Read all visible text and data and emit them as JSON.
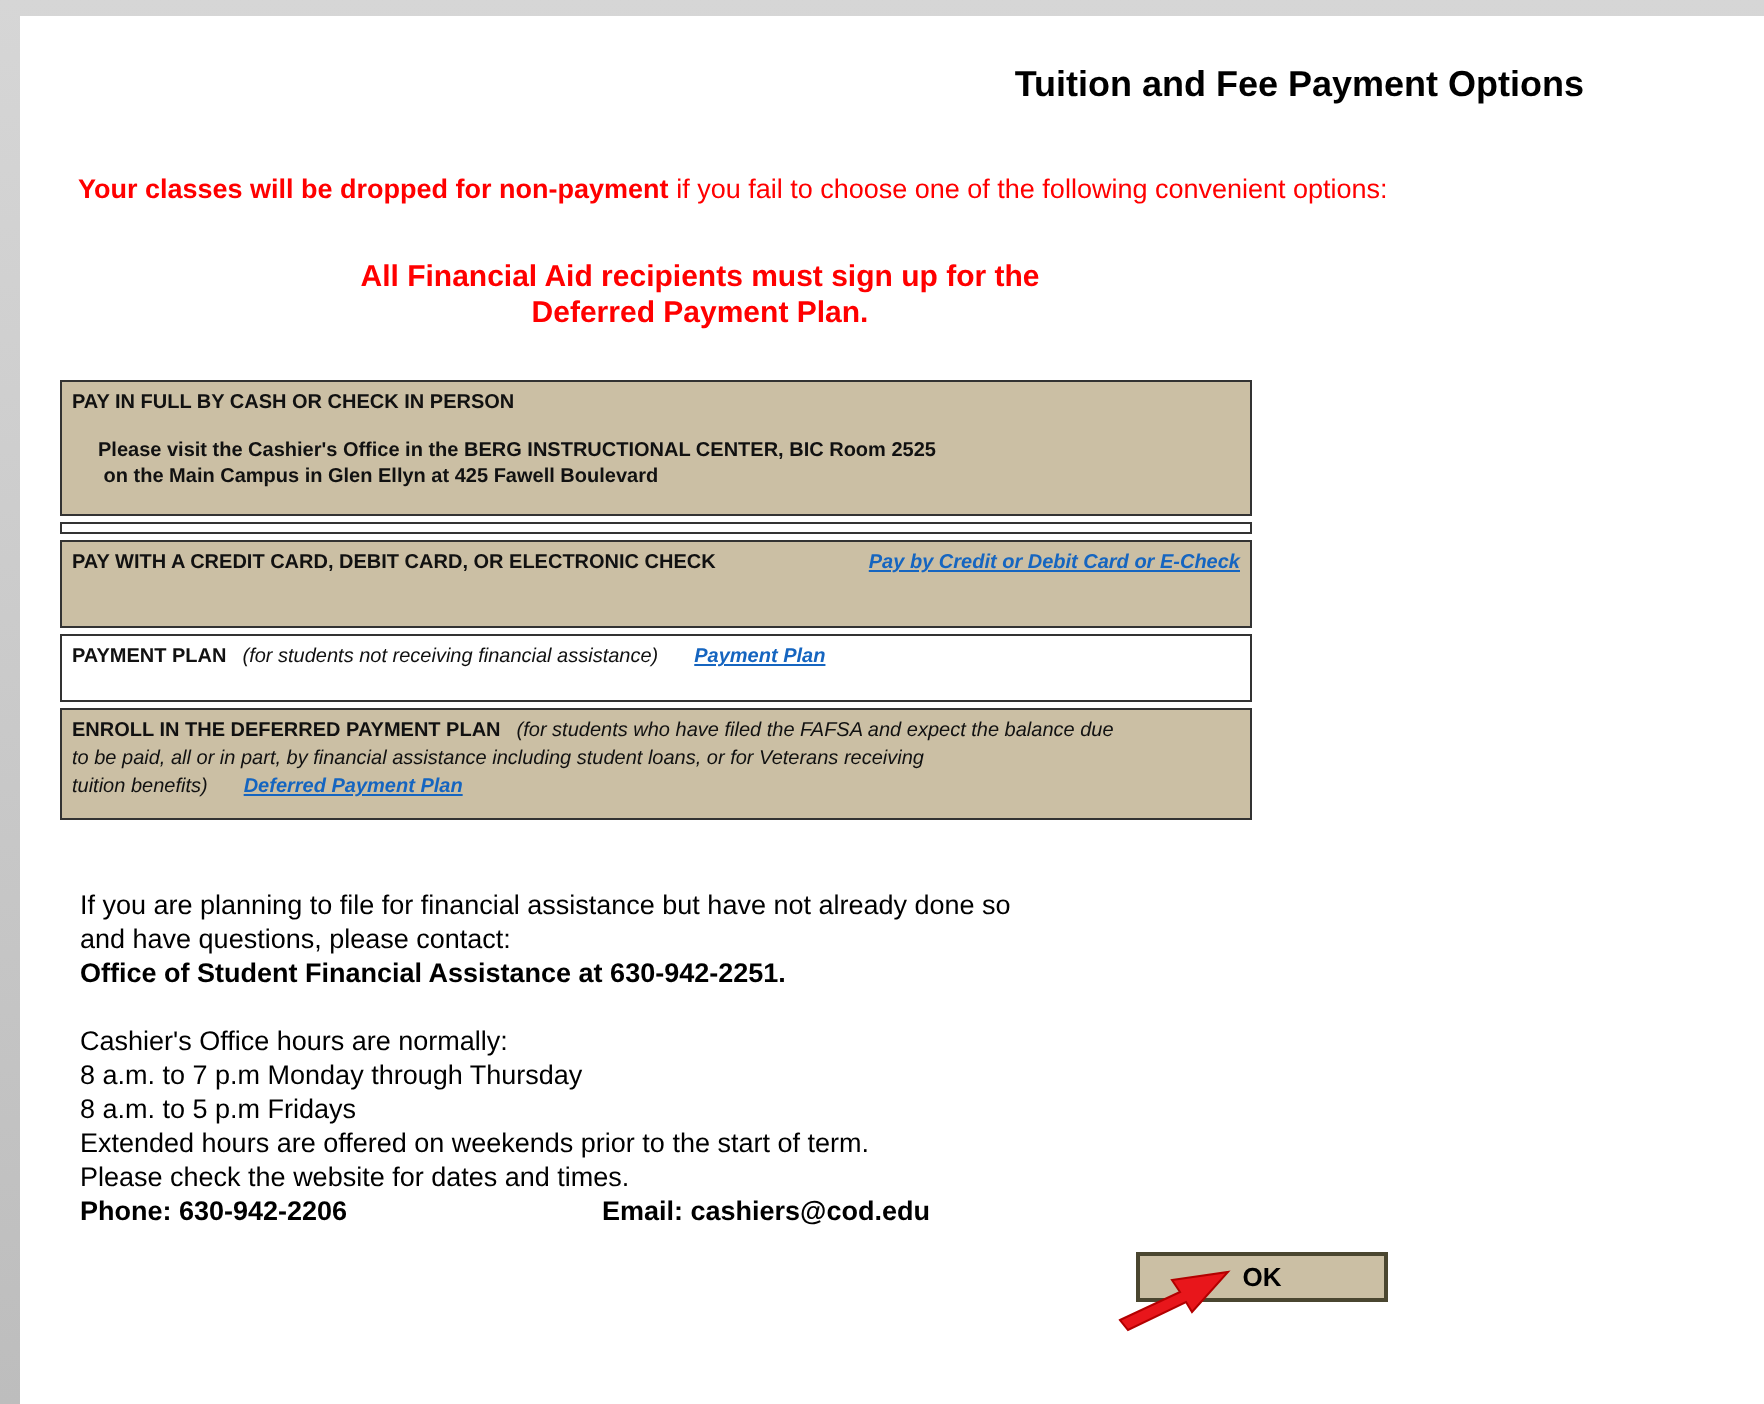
{
  "title": "Tuition and Fee Payment Options",
  "warning": {
    "bold": "Your classes will be dropped for non-payment",
    "rest": " if you fail to choose one of the following convenient options:"
  },
  "aid_note": "All Financial Aid recipients must sign up for the\nDeferred Payment Plan.",
  "options": [
    {
      "heading": "PAY IN FULL BY CASH OR CHECK IN PERSON",
      "shaded": true,
      "details": [
        "Please visit the Cashier's Office in the BERG INSTRUCTIONAL CENTER, BIC Room 2525",
        " on the Main Campus in Glen Ellyn at 425 Fawell Boulevard"
      ]
    },
    {
      "heading": "PAY WITH A CREDIT CARD, DEBIT CARD, OR ELECTRONIC CHECK",
      "shaded": true,
      "link": "Pay by Credit or Debit Card or E-Check",
      "kind": "link-right"
    },
    {
      "heading": "PAYMENT PLAN",
      "shaded": false,
      "note": "(for students not receiving financial assistance)",
      "link": "Payment Plan",
      "kind": "link-inline"
    },
    {
      "heading": "ENROLL IN THE DEFERRED PAYMENT PLAN",
      "shaded": true,
      "note": "(for students who have filed the FAFSA and expect the balance due\nto be paid, all or in part, by financial assistance including student loans, or for Veterans receiving\ntuition benefits)",
      "link": "Deferred Payment Plan",
      "kind": "link-inline"
    }
  ],
  "info": [
    {
      "text": "If you are planning to file for financial assistance but have not already done so\nand have questions, please contact:",
      "bold": false
    },
    {
      "text": "Office of Student Financial Assistance at 630-942-2251.",
      "bold": true
    }
  ],
  "hours": "Cashier's Office hours are normally:\n8 a.m. to 7 p.m Monday through Thursday\n8 a.m. to 5 p.m Fridays\nExtended hours are offered on weekends prior to the start of term.\nPlease check the website for dates and times.",
  "phone": "Phone: 630-942-2206",
  "email": "Email: cashiers@cod.edu",
  "ok_button": "OK"
}
